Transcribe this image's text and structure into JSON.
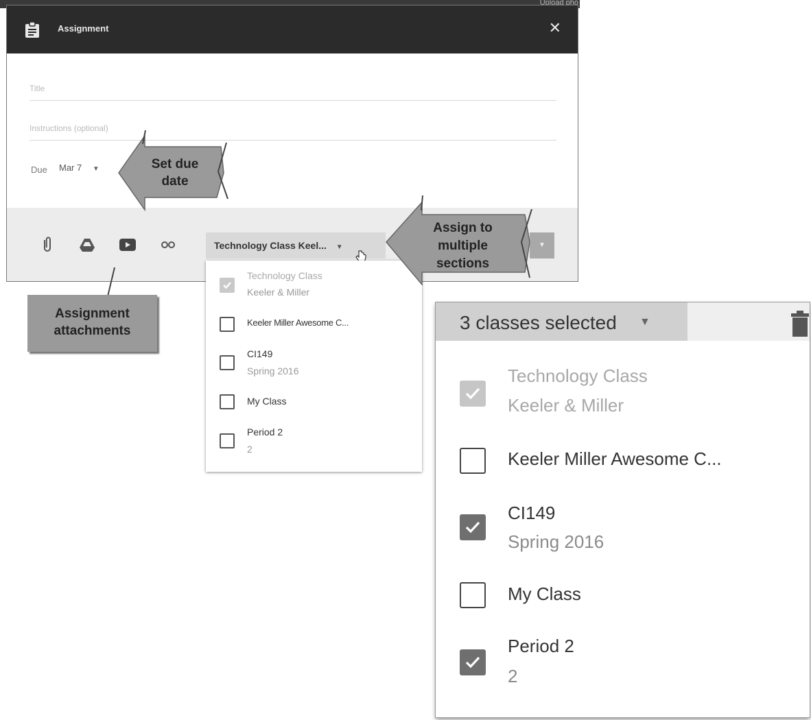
{
  "background": {
    "corner_text": "Upload pho"
  },
  "dialog": {
    "title": "Assignment",
    "icon": "clipboard-icon",
    "close_icon": "close-icon",
    "title_placeholder": "Title",
    "instructions_placeholder": "Instructions (optional)",
    "due_label": "Due",
    "due_value": "Mar 7",
    "attachments": [
      "attachment-icon",
      "drive-icon",
      "youtube-icon",
      "link-icon"
    ],
    "class_select_label": "Technology Class Keel..."
  },
  "small_dropdown": {
    "items": [
      {
        "name": "Technology Class",
        "sub": "Keeler & Miller",
        "checked": true,
        "disabled": true
      },
      {
        "name": "Keeler Miller Awesome C...",
        "sub": "",
        "checked": false,
        "disabled": false
      },
      {
        "name": "CI149",
        "sub": "Spring 2016",
        "checked": false,
        "disabled": false
      },
      {
        "name": "My Class",
        "sub": "",
        "checked": false,
        "disabled": false
      },
      {
        "name": "Period 2",
        "sub": "2",
        "checked": false,
        "disabled": false
      }
    ]
  },
  "big_panel": {
    "header_label": "3 classes selected",
    "trash_icon": "trash-icon",
    "items": [
      {
        "name": "Technology Class",
        "sub": "Keeler & Miller",
        "checked": true,
        "disabled": true
      },
      {
        "name": "Keeler Miller Awesome C...",
        "sub": "",
        "checked": false,
        "disabled": false
      },
      {
        "name": "CI149",
        "sub": "Spring 2016",
        "checked": true,
        "disabled": false
      },
      {
        "name": "My Class",
        "sub": "",
        "checked": false,
        "disabled": false
      },
      {
        "name": "Period 2",
        "sub": "2",
        "checked": true,
        "disabled": false
      }
    ]
  },
  "callouts": {
    "set_due_date": {
      "line1": "Set due",
      "line2": "date"
    },
    "assign_sections": {
      "line1": "Assign to",
      "line2": "multiple",
      "line3": "sections"
    },
    "attachments": {
      "line1": "Assignment",
      "line2": "attachments"
    }
  },
  "colors": {
    "header_bg": "#2b2b2b",
    "callout_fill": "#9a9a9a",
    "footer_bg": "#ececec"
  }
}
